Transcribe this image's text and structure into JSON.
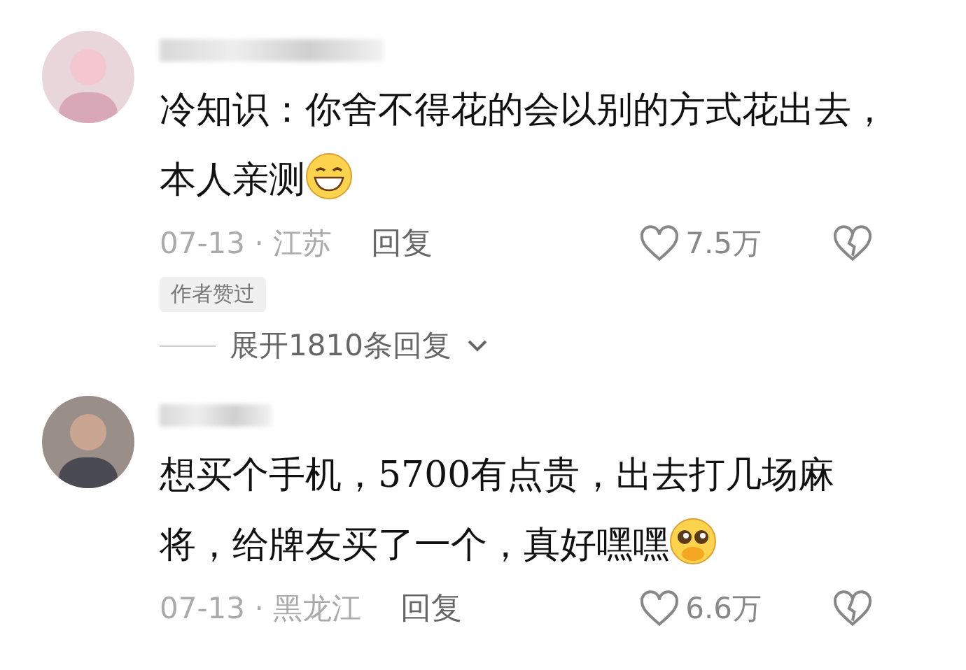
{
  "comments": [
    {
      "text": "冷知识：你舍不得花的会以别的方式花出去，本人亲测",
      "emoji": {
        "kind": "grin"
      },
      "meta": "07-13 · 江苏",
      "reply": "回复",
      "likes": "7.5万",
      "author_liked": true,
      "author_liked_label": "作者赞过",
      "expand": "展开1810条回复"
    },
    {
      "text": "想买个手机，5700有点贵，出去打几场麻将，给牌友买了一个，真好嘿嘿",
      "emoji": {
        "kind": "pleading"
      },
      "meta": "07-13 · 黑龙江",
      "reply": "回复",
      "likes": "6.6万",
      "author_liked": false
    }
  ]
}
